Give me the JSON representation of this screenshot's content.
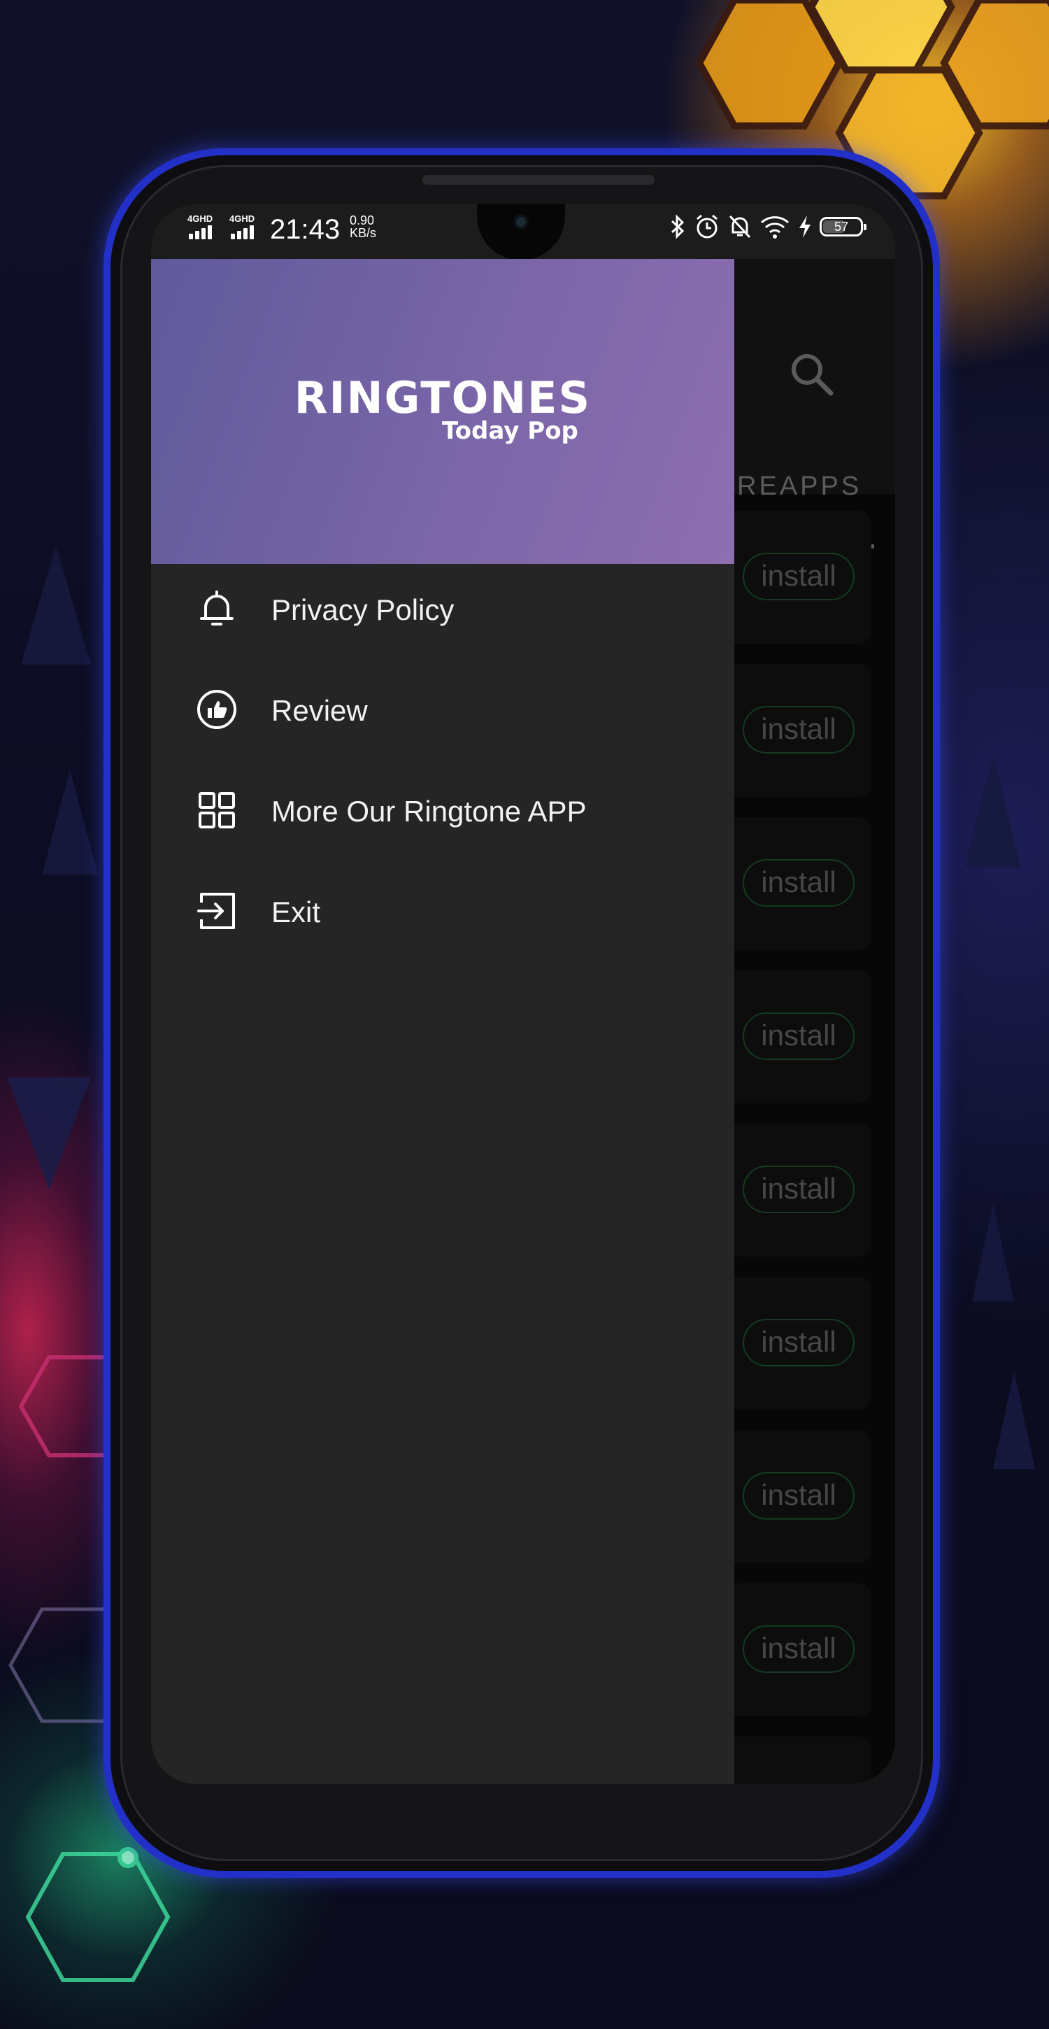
{
  "status_bar": {
    "network_1": "4GHD",
    "network_2": "4GHD",
    "time": "21:43",
    "speed_value": "0.90",
    "speed_unit": "KB/s",
    "battery": "57",
    "icons": [
      "bluetooth-icon",
      "alarm-icon",
      "mute-icon",
      "wifi-icon",
      "charging-icon"
    ]
  },
  "app": {
    "tab_label": "REAPPS",
    "cards": [
      {
        "install_label": "install"
      },
      {
        "install_label": "install"
      },
      {
        "install_label": "install"
      },
      {
        "install_label": "install"
      },
      {
        "install_label": "install"
      },
      {
        "install_label": "install"
      },
      {
        "install_label": "install"
      },
      {
        "install_label": "install"
      }
    ]
  },
  "drawer": {
    "logo_title": "RINGTONES",
    "logo_subtitle": "Today Pop",
    "menu": [
      {
        "label": "Privacy Policy",
        "icon": "bell-icon"
      },
      {
        "label": "Review",
        "icon": "thumbs-up-icon"
      },
      {
        "label": "More Our Ringtone APP",
        "icon": "grid-icon"
      },
      {
        "label": "Exit",
        "icon": "exit-icon"
      }
    ]
  },
  "colors": {
    "drawer_bg": "#252525",
    "header_gradient_start": "#5f5a9a",
    "header_gradient_end": "#8e6fb0",
    "install_border": "#1f5a33",
    "phone_frame": "#2330c8"
  }
}
